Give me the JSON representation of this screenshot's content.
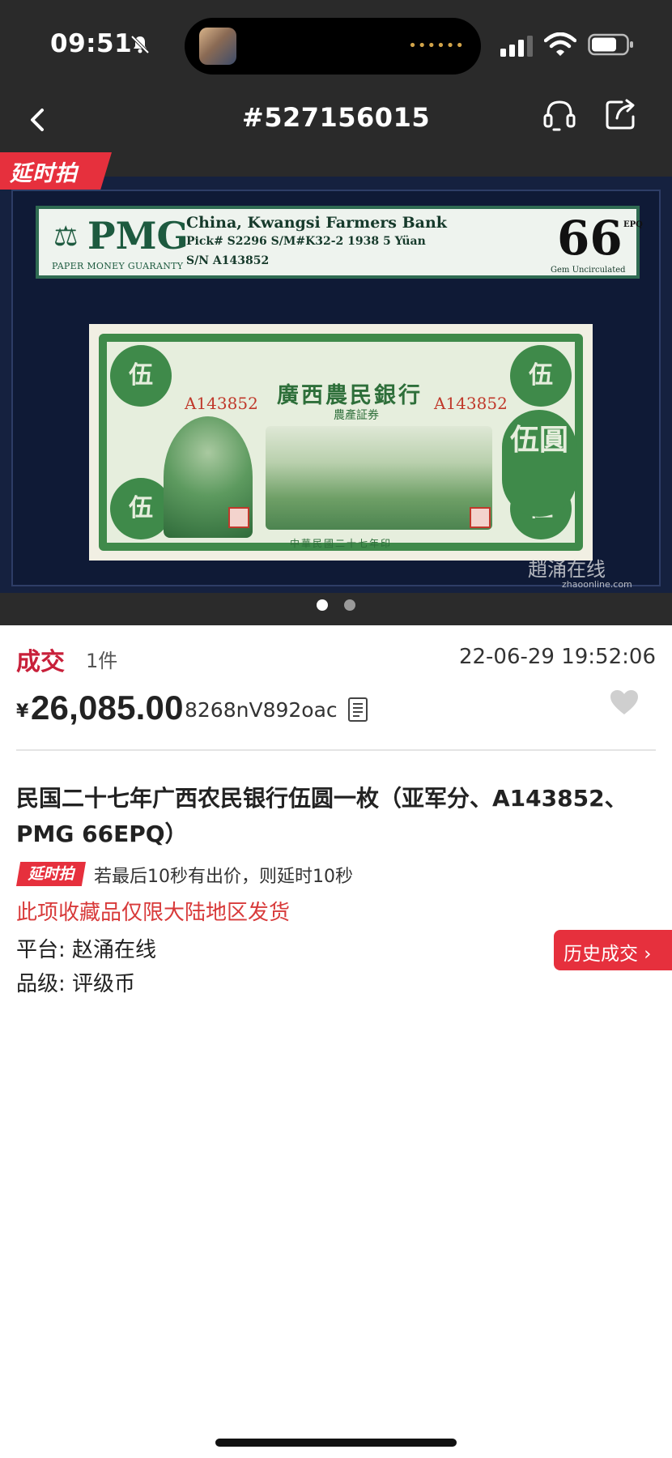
{
  "status_bar": {
    "time": "09:51"
  },
  "header": {
    "title": "#527156015"
  },
  "gallery": {
    "badge": "延时拍",
    "slab": {
      "brand": "PMG",
      "brand_sub": "PAPER MONEY GUARANTY",
      "line1": "China, Kwangsi Farmers Bank",
      "line2": "Pick# S2296  S/M#K32-2   1938  5 Yüan",
      "line3": "S/N A143852",
      "grade": "66",
      "grade_suffix": "EPQ",
      "grade_desc": "Gem Uncirculated"
    },
    "note": {
      "issuer": "廣西農民銀行",
      "sub": "農產証券",
      "serial": "A143852",
      "value": "伍圓",
      "corner": "伍",
      "date": "中華民國二十七年印"
    },
    "watermark": "趙涌在线",
    "watermark_sub": "zhaoonline.com",
    "page_count": 2,
    "active_page": 1
  },
  "deal": {
    "status": "成交",
    "quantity": "1件",
    "time": "22-06-29 19:52:06",
    "currency": "¥",
    "price": "26,085.00",
    "buyer": "8268nV892oac"
  },
  "item": {
    "title": "民国二十七年广西农民银行伍圆一枚（亚军分、A143852、PMG 66EPQ）",
    "badge": "延时拍",
    "delay_rule": "若最后10秒有出价，则延时10秒",
    "shipping_notice": "此项收藏品仅限大陆地区发货",
    "platform": "平台: 赵涌在线",
    "grade": "品级: 评级币",
    "history_button": "历史成交 ›"
  },
  "colors": {
    "accent": "#e6303d",
    "deal_red": "#c8203a",
    "header_bg": "#2a2a2a"
  }
}
